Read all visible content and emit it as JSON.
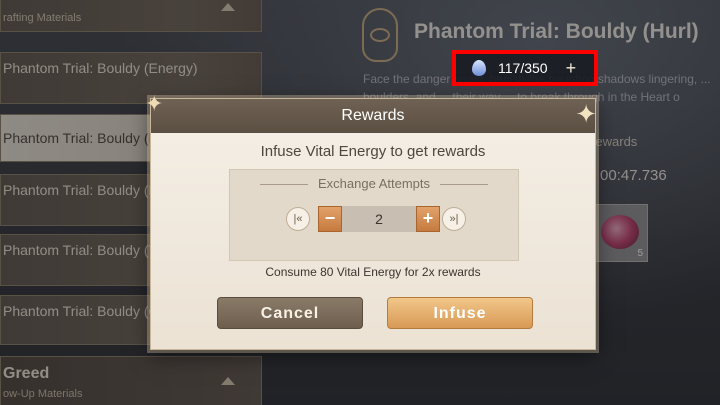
{
  "sidebar": {
    "header_label": "rafting Materials",
    "items": [
      {
        "label": "Phantom Trial: Bouldy (Energy)"
      },
      {
        "label": "Phantom Trial: Bouldy (Hu"
      },
      {
        "label": "Phantom Trial: Bouldy (Plummet)"
      },
      {
        "label": "Phantom Trial: Bouldy (Tumble)"
      },
      {
        "label": "Phantom Trial: Bouldy (Command)"
      }
    ],
    "footer": {
      "title": "Greed",
      "subtitle": "ow-Up Materials"
    }
  },
  "detail": {
    "title": "Phantom Trial: Bouldy (Hurl)",
    "energy": {
      "value": "117/350",
      "plus": "+"
    },
    "description": "Face the danger again, banish the haunting shadows lingering, ... boulders, and ... their way ... to break through in the Heart o",
    "rewards_label": "Rewards",
    "best_time": "00:47.736",
    "reward_count": "5"
  },
  "modal": {
    "title": "Rewards",
    "subtitle": "Infuse Vital Energy to get rewards",
    "exchange_label": "Exchange Attempts",
    "quantity": "2",
    "consume_text": "Consume 80 Vital Energy for 2x rewards",
    "cancel_label": "Cancel",
    "confirm_label": "Infuse",
    "stepper": {
      "min_glyph": "|«",
      "dec_glyph": "−",
      "inc_glyph": "+",
      "max_glyph": "»|"
    }
  },
  "colors": {
    "accent": "#d89a55",
    "highlight": "#ff0000",
    "header": "#5b4f43"
  }
}
